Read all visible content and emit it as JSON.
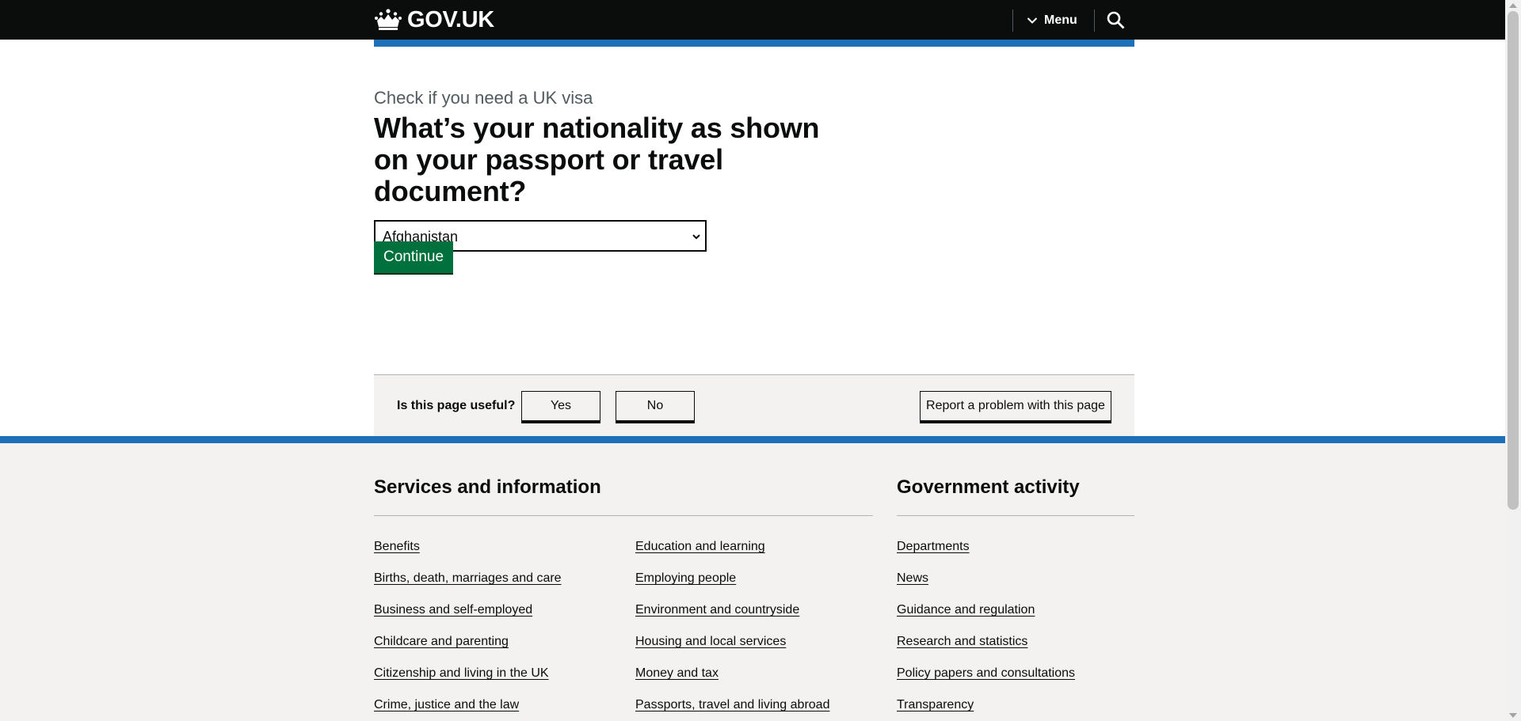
{
  "header": {
    "logo_text": "GOV.UK",
    "menu_label": "Menu"
  },
  "main": {
    "caption": "Check if you need a UK visa",
    "heading": "What’s your nationality as shown on your passport or travel document?",
    "nationality_select": {
      "selected": "Afghanistan"
    },
    "continue_label": "Continue"
  },
  "feedback": {
    "question": "Is this page useful?",
    "yes_label": "Yes",
    "no_label": "No",
    "report_label": "Report a problem with this page"
  },
  "footer": {
    "services_title": "Services and information",
    "services_col1": [
      "Benefits",
      "Births, death, marriages and care",
      "Business and self-employed",
      "Childcare and parenting",
      "Citizenship and living in the UK",
      "Crime, justice and the law"
    ],
    "services_col2": [
      "Education and learning",
      "Employing people",
      "Environment and countryside",
      "Housing and local services",
      "Money and tax",
      "Passports, travel and living abroad"
    ],
    "gov_title": "Government activity",
    "gov_links": [
      "Departments",
      "News",
      "Guidance and regulation",
      "Research and statistics",
      "Policy papers and consultations",
      "Transparency"
    ]
  },
  "colors": {
    "header_bg": "#0b0c0c",
    "brand_blue": "#1d70b8",
    "button_green": "#00703c",
    "footer_bg": "#f3f2f1"
  },
  "icons": {
    "logo": "crown-icon",
    "menu": "chevron-down-icon",
    "search": "search-icon",
    "select": "dropdown-arrow-icon"
  }
}
